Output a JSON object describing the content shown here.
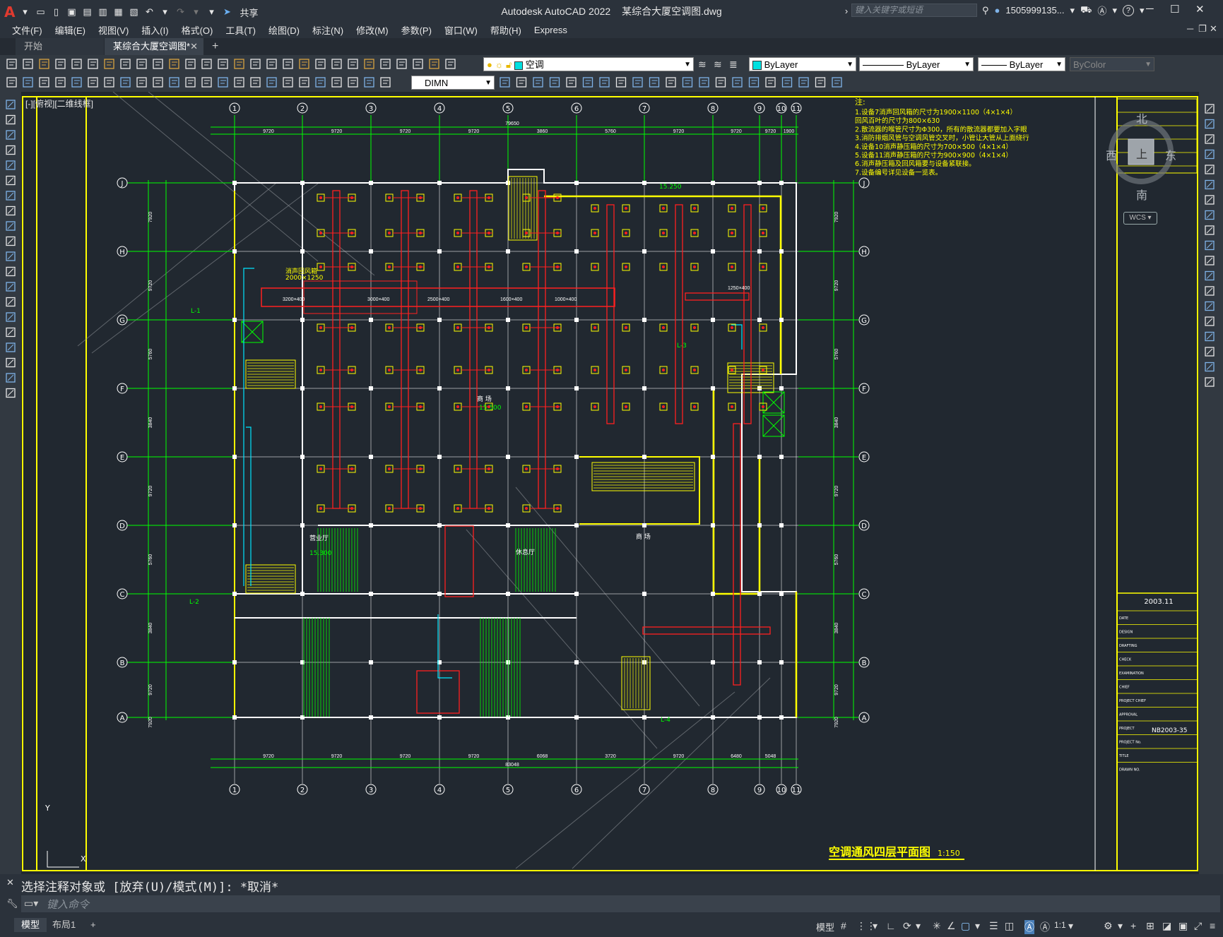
{
  "app": {
    "logo": "A",
    "title": "Autodesk AutoCAD 2022",
    "file": "某综合大厦空调图.dwg",
    "share": "共享",
    "search_placeholder": "键入关键字或短语",
    "user": "1505999135...",
    "help": "?"
  },
  "menu": [
    "文件(F)",
    "编辑(E)",
    "视图(V)",
    "插入(I)",
    "格式(O)",
    "工具(T)",
    "绘图(D)",
    "标注(N)",
    "修改(M)",
    "参数(P)",
    "窗口(W)",
    "帮助(H)",
    "Express"
  ],
  "tabs": {
    "start": "开始",
    "active": "某综合大厦空调图*",
    "close": "✕",
    "add": "+"
  },
  "toolbar": {
    "layer": "空调",
    "color": "ByLayer",
    "linetype": "ByLayer",
    "lineweight": "ByLayer",
    "plotstyle": "ByColor",
    "dimstyle": "DIMN"
  },
  "viewport": {
    "label": "[-][俯视][二维线框]"
  },
  "viewcube": {
    "north": "北",
    "south": "南",
    "east": "东",
    "west": "西",
    "top": "上",
    "wcs": "WCS ▾"
  },
  "drawing": {
    "grid_cols": [
      "1",
      "2",
      "3",
      "4",
      "5",
      "6",
      "7",
      "8",
      "9",
      "10",
      "11"
    ],
    "grid_rows": [
      "J",
      "H",
      "G",
      "F",
      "E",
      "D",
      "C",
      "B",
      "A"
    ],
    "notes_title": "注:",
    "notes": [
      "1.设备7消声回风箱的尺寸为1900×1100（4×1×4）",
      "  回风百叶的尺寸为800×630",
      "2.散流器的喉管尺寸为Φ300，所有的散流器都要加入字眼",
      "3.消防排烟风管与空调风管交叉时，小管让大管从上面绕行",
      "4.设备10消声静压箱的尺寸为700×500（4×1×4）",
      "5.设备11消声静压箱的尺寸为900×900（4×1×4）",
      "6.消声静压箱及回风箱要与设备紧联接。",
      "7.设备编号详见设备一览表。"
    ],
    "plan_title": "空调通风四层平面图",
    "scale": "1:150",
    "date": "2003.11",
    "project_no": "NB2003-35",
    "tb_rows": [
      "DATE",
      "DESIGN",
      "DRAFTING",
      "CHECK",
      "EXAMINATION",
      "CHIEF",
      "PROJECT CHIEF",
      "APPROVAL",
      "PROJECT",
      "PROJECT No.",
      "TITLE",
      "DRAWN NO."
    ],
    "overall_top": "79650",
    "overall_bottom": "83048",
    "dims_top": [
      "9720",
      "9720",
      "9720",
      "9720",
      "3860",
      "5760",
      "9720",
      "9720",
      "9720",
      "1900"
    ],
    "dims_bottom": [
      "9720",
      "9720",
      "9720",
      "9720",
      "6068",
      "3720",
      "9720",
      "6480",
      "5048"
    ],
    "dims_left": [
      "7920",
      "9720",
      "5760",
      "3840",
      "9720",
      "5760",
      "3840",
      "9720",
      "7920"
    ],
    "duct_labels": [
      "3200×400",
      "3000×400",
      "2500×400",
      "1600×400",
      "1000×400",
      "1250×400"
    ],
    "room_labels": [
      "消声回风箱",
      "2000×1250",
      "L-1",
      "L-2",
      "L-3",
      "L-4",
      "商 场",
      "商 场",
      "15.500",
      "15.300",
      "15.250",
      "营业厅",
      "休息厅"
    ]
  },
  "command": {
    "history": "选择注释对象或 [放弃(U)/模式(M)]: *取消*",
    "placeholder": "键入命令"
  },
  "status": {
    "model_tab": "模型",
    "layout_tab": "布局1",
    "add": "+",
    "model_btn": "模型",
    "scale": "1:1"
  }
}
